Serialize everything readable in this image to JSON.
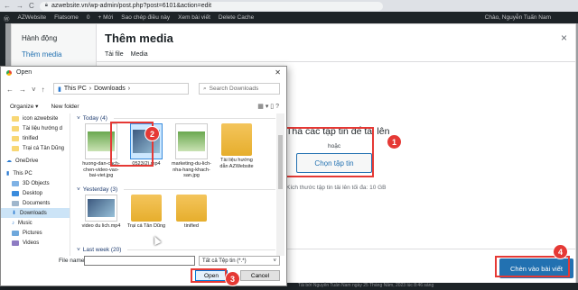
{
  "browser": {
    "url": "azwebsite.vn/wp-admin/post.php?post=6101&action=edit",
    "back": "←",
    "forward": "→",
    "reload": "C"
  },
  "adminbar": {
    "items": [
      "AZWebsite",
      "Flatsome",
      "0",
      "+ Mới",
      "Sao chép điều này",
      "Xem bài viết",
      "Delete Cache"
    ],
    "user": "Chào, Nguyễn Tuấn Nam"
  },
  "modal": {
    "menu_title": "Hành động",
    "menu_item": "Thêm media",
    "title": "Thêm media",
    "close": "×",
    "tabs": [
      "Tải file",
      "Media"
    ],
    "drop_title": "Thả các tập tin để tải lên",
    "or": "hoặc",
    "select_button": "Chọn tập tin",
    "max_size": "Kích thước tập tin tải lên tối đa: 10 GB",
    "insert_button": "Chèn vào bài viết"
  },
  "status_text": "Tải bởi Nguyễn Tuấn Nam ngày 25 Tháng Năm, 2023 lúc 8:46 sáng",
  "dialog": {
    "title": "Open",
    "close": "✕",
    "path_root": "This PC",
    "path_folder": "Downloads",
    "search_placeholder": "Search Downloads",
    "organize": "Organize ▾",
    "new_folder": "New folder",
    "nav_items": [
      {
        "label": "icon azwebsite",
        "type": "folder"
      },
      {
        "label": "Tài liệu hướng d",
        "type": "folder"
      },
      {
        "label": "tinified",
        "type": "folder"
      },
      {
        "label": "Trại cá Tân Dũng",
        "type": "folder"
      },
      {
        "label": "OneDrive",
        "type": "cloud"
      },
      {
        "label": "This PC",
        "type": "pc"
      },
      {
        "label": "3D Objects",
        "type": "folder"
      },
      {
        "label": "Desktop",
        "type": "folder"
      },
      {
        "label": "Documents",
        "type": "folder"
      },
      {
        "label": "Downloads",
        "type": "download"
      },
      {
        "label": "Music",
        "type": "folder"
      },
      {
        "label": "Pictures",
        "type": "folder"
      },
      {
        "label": "Videos",
        "type": "folder"
      }
    ],
    "groups": [
      {
        "label": "Today (4)",
        "files": [
          {
            "name": "huong-dan-cach-chen-video-vao-bai-viet.jpg",
            "kind": "doc"
          },
          {
            "name": "0523(2).mp4",
            "kind": "vid"
          },
          {
            "name": "marketing-du-lich-nha-hang-khach-san.jpg",
            "kind": "doc"
          },
          {
            "name": "Tài liệu hướng dẫn AZWebsite",
            "kind": "folder"
          }
        ]
      },
      {
        "label": "Yesterday (3)",
        "files": [
          {
            "name": "video du lich.mp4",
            "kind": "vid"
          },
          {
            "name": "Trại cá Tân Dũng",
            "kind": "folder"
          },
          {
            "name": "tinified",
            "kind": "folder"
          }
        ]
      },
      {
        "label": "Last week (20)",
        "files": []
      }
    ],
    "file_name_label": "File name:",
    "filter": "Tất cả Tệp tin (*.*)",
    "open_button": "Open",
    "cancel_button": "Cancel"
  },
  "markers": [
    "1",
    "2",
    "3",
    "4"
  ]
}
